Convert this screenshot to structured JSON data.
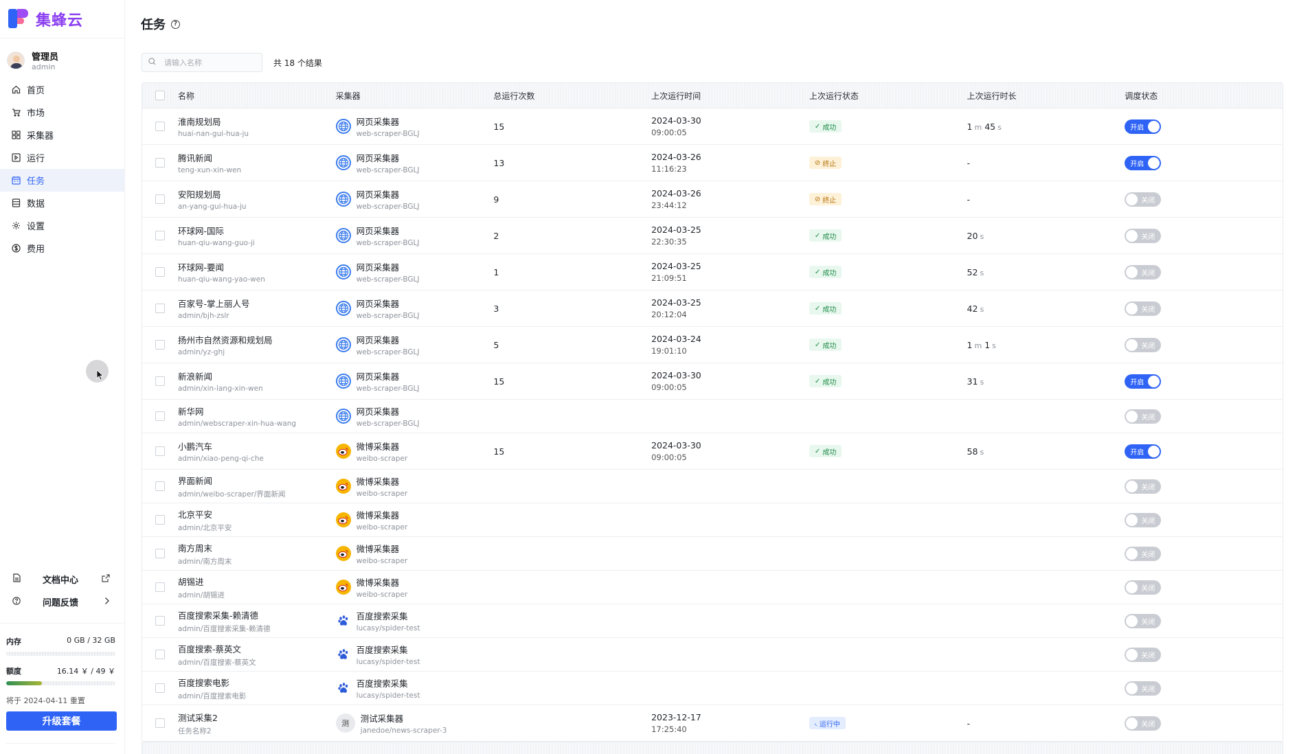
{
  "brand": {
    "name": "集蜂云"
  },
  "user": {
    "name": "管理员",
    "account": "admin"
  },
  "nav": [
    {
      "label": "首页",
      "icon": "home-icon",
      "active": false
    },
    {
      "label": "市场",
      "icon": "cart-icon",
      "active": false
    },
    {
      "label": "采集器",
      "icon": "grid-icon",
      "active": false
    },
    {
      "label": "运行",
      "icon": "run-icon",
      "active": false
    },
    {
      "label": "任务",
      "icon": "calendar-icon",
      "active": true
    },
    {
      "label": "数据",
      "icon": "database-icon",
      "active": false
    },
    {
      "label": "设置",
      "icon": "gear-icon",
      "active": false
    },
    {
      "label": "费用",
      "icon": "dollar-icon",
      "active": false
    }
  ],
  "bottom": {
    "docs_label": "文档中心",
    "feedback_label": "问题反馈",
    "memory_label": "内存",
    "memory_value": "0 GB / 32 GB",
    "memory_fraction": 0,
    "quota_label": "额度",
    "quota_value": "16.14 ￥ / 49 ￥",
    "quota_fraction": 0.33,
    "reset_text": "将于 2024-04-11 重置",
    "upgrade_label": "升级套餐"
  },
  "page": {
    "title": "任务",
    "search_placeholder": "请输入名称",
    "result_count": "共 18 个结果"
  },
  "columns": [
    "名称",
    "采集器",
    "总运行次数",
    "上次运行时间",
    "上次运行状态",
    "上次运行时长",
    "调度状态"
  ],
  "rows": [
    {
      "name": "淮南规划局",
      "slug": "huai-nan-gui-hua-ju",
      "scraper": "网页采集器",
      "scraper_id": "web-scraper-BGLJ",
      "scraper_type": "web",
      "runs": "15",
      "date": "2024-03-30",
      "time": "09:00:05",
      "status": "成功",
      "status_type": "ok",
      "duration": [
        [
          "1",
          "m"
        ],
        [
          "45",
          "s"
        ]
      ],
      "schedule": "开启",
      "on": true,
      "height": 53
    },
    {
      "name": "腾讯新闻",
      "slug": "teng-xun-xin-wen",
      "scraper": "网页采集器",
      "scraper_id": "web-scraper-BGLJ",
      "scraper_type": "web",
      "runs": "13",
      "date": "2024-03-26",
      "time": "11:16:23",
      "status": "终止",
      "status_type": "stop",
      "duration_text": "-",
      "schedule": "开启",
      "on": true,
      "height": 53
    },
    {
      "name": "安阳规划局",
      "slug": "an-yang-gui-hua-ju",
      "scraper": "网页采集器",
      "scraper_id": "web-scraper-BGLJ",
      "scraper_type": "web",
      "runs": "9",
      "date": "2024-03-26",
      "time": "23:44:12",
      "status": "终止",
      "status_type": "stop",
      "duration_text": "-",
      "schedule": "关闭",
      "on": false,
      "height": 53
    },
    {
      "name": "环球网-国际",
      "slug": "huan-qiu-wang-guo-ji",
      "scraper": "网页采集器",
      "scraper_id": "web-scraper-BGLJ",
      "scraper_type": "web",
      "runs": "2",
      "date": "2024-03-25",
      "time": "22:30:35",
      "status": "成功",
      "status_type": "ok",
      "duration": [
        [
          "20",
          "s"
        ]
      ],
      "schedule": "关闭",
      "on": false,
      "height": 53
    },
    {
      "name": "环球网-要闻",
      "slug": "huan-qiu-wang-yao-wen",
      "scraper": "网页采集器",
      "scraper_id": "web-scraper-BGLJ",
      "scraper_type": "web",
      "runs": "1",
      "date": "2024-03-25",
      "time": "21:09:51",
      "status": "成功",
      "status_type": "ok",
      "duration": [
        [
          "52",
          "s"
        ]
      ],
      "schedule": "关闭",
      "on": false,
      "height": 53
    },
    {
      "name": "百家号-掌上丽人号",
      "slug": "admin/bjh-zslr",
      "scraper": "网页采集器",
      "scraper_id": "web-scraper-BGLJ",
      "scraper_type": "web",
      "runs": "3",
      "date": "2024-03-25",
      "time": "20:12:04",
      "status": "成功",
      "status_type": "ok",
      "duration": [
        [
          "42",
          "s"
        ]
      ],
      "schedule": "关闭",
      "on": false,
      "height": 53
    },
    {
      "name": "扬州市自然资源和规划局",
      "slug": "admin/yz-ghj",
      "scraper": "网页采集器",
      "scraper_id": "web-scraper-BGLJ",
      "scraper_type": "web",
      "runs": "5",
      "date": "2024-03-24",
      "time": "19:01:10",
      "status": "成功",
      "status_type": "ok",
      "duration": [
        [
          "1",
          "m"
        ],
        [
          "1",
          "s"
        ]
      ],
      "schedule": "关闭",
      "on": false,
      "height": 53
    },
    {
      "name": "新浪新闻",
      "slug": "admin/xin-lang-xin-wen",
      "scraper": "网页采集器",
      "scraper_id": "web-scraper-BGLJ",
      "scraper_type": "web",
      "runs": "15",
      "date": "2024-03-30",
      "time": "09:00:05",
      "status": "成功",
      "status_type": "ok",
      "duration": [
        [
          "31",
          "s"
        ]
      ],
      "schedule": "开启",
      "on": true,
      "height": 53
    },
    {
      "name": "新华网",
      "slug": "admin/webscraper-xin-hua-wang",
      "scraper": "网页采集器",
      "scraper_id": "web-scraper-BGLJ",
      "scraper_type": "web",
      "runs": "",
      "date": "",
      "time": "",
      "status": "",
      "status_type": "",
      "duration_text": "",
      "schedule": "关闭",
      "on": false,
      "height": 49
    },
    {
      "name": "小鹏汽车",
      "slug": "admin/xiao-peng-qi-che",
      "scraper": "微博采集器",
      "scraper_id": "weibo-scraper",
      "scraper_type": "weibo",
      "runs": "15",
      "date": "2024-03-30",
      "time": "09:00:05",
      "status": "成功",
      "status_type": "ok",
      "duration": [
        [
          "58",
          "s"
        ]
      ],
      "schedule": "开启",
      "on": true,
      "height": 53
    },
    {
      "name": "界面新闻",
      "slug": "admin/weibo-scraper/界面新闻",
      "scraper": "微博采集器",
      "scraper_id": "weibo-scraper",
      "scraper_type": "weibo",
      "runs": "",
      "date": "",
      "time": "",
      "status": "",
      "status_type": "",
      "duration_text": "",
      "schedule": "关闭",
      "on": false,
      "height": 49
    },
    {
      "name": "北京平安",
      "slug": "admin/北京平安",
      "scraper": "微博采集器",
      "scraper_id": "weibo-scraper",
      "scraper_type": "weibo",
      "runs": "",
      "date": "",
      "time": "",
      "status": "",
      "status_type": "",
      "duration_text": "",
      "schedule": "关闭",
      "on": false,
      "height": 49
    },
    {
      "name": "南方周末",
      "slug": "admin/南方周末",
      "scraper": "微博采集器",
      "scraper_id": "weibo-scraper",
      "scraper_type": "weibo",
      "runs": "",
      "date": "",
      "time": "",
      "status": "",
      "status_type": "",
      "duration_text": "",
      "schedule": "关闭",
      "on": false,
      "height": 49
    },
    {
      "name": "胡锡进",
      "slug": "admin/胡锡进",
      "scraper": "微博采集器",
      "scraper_id": "weibo-scraper",
      "scraper_type": "weibo",
      "runs": "",
      "date": "",
      "time": "",
      "status": "",
      "status_type": "",
      "duration_text": "",
      "schedule": "关闭",
      "on": false,
      "height": 49
    },
    {
      "name": "百度搜索采集-赖清德",
      "slug": "admin/百度搜索采集-赖清德",
      "scraper": "百度搜索采集",
      "scraper_id": "lucasy/spider-test",
      "scraper_type": "baidu",
      "runs": "",
      "date": "",
      "time": "",
      "status": "",
      "status_type": "",
      "duration_text": "",
      "schedule": "关闭",
      "on": false,
      "height": 49
    },
    {
      "name": "百度搜索-蔡英文",
      "slug": "admin/百度搜索-蔡英文",
      "scraper": "百度搜索采集",
      "scraper_id": "lucasy/spider-test",
      "scraper_type": "baidu",
      "runs": "",
      "date": "",
      "time": "",
      "status": "",
      "status_type": "",
      "duration_text": "",
      "schedule": "关闭",
      "on": false,
      "height": 49
    },
    {
      "name": "百度搜索电影",
      "slug": "admin/百度搜索电影",
      "scraper": "百度搜索采集",
      "scraper_id": "lucasy/spider-test",
      "scraper_type": "baidu",
      "runs": "",
      "date": "",
      "time": "",
      "status": "",
      "status_type": "",
      "duration_text": "",
      "schedule": "关闭",
      "on": false,
      "height": 49
    },
    {
      "name": "测试采集2",
      "slug": "任务名称2",
      "scraper": "测试采集器",
      "scraper_id": "janedoe/news-scraper-3",
      "scraper_type": "test",
      "scraper_glyph": "测",
      "runs": "",
      "date": "2023-12-17",
      "time": "17:25:40",
      "status": "运行中",
      "status_type": "run",
      "duration_text": "-",
      "schedule": "关闭",
      "on": false,
      "height": 53
    }
  ],
  "colors": {
    "accent": "#2e63f6",
    "brand": "#8b3ff0",
    "success": "#1d8a46",
    "warn": "#b6720a"
  }
}
